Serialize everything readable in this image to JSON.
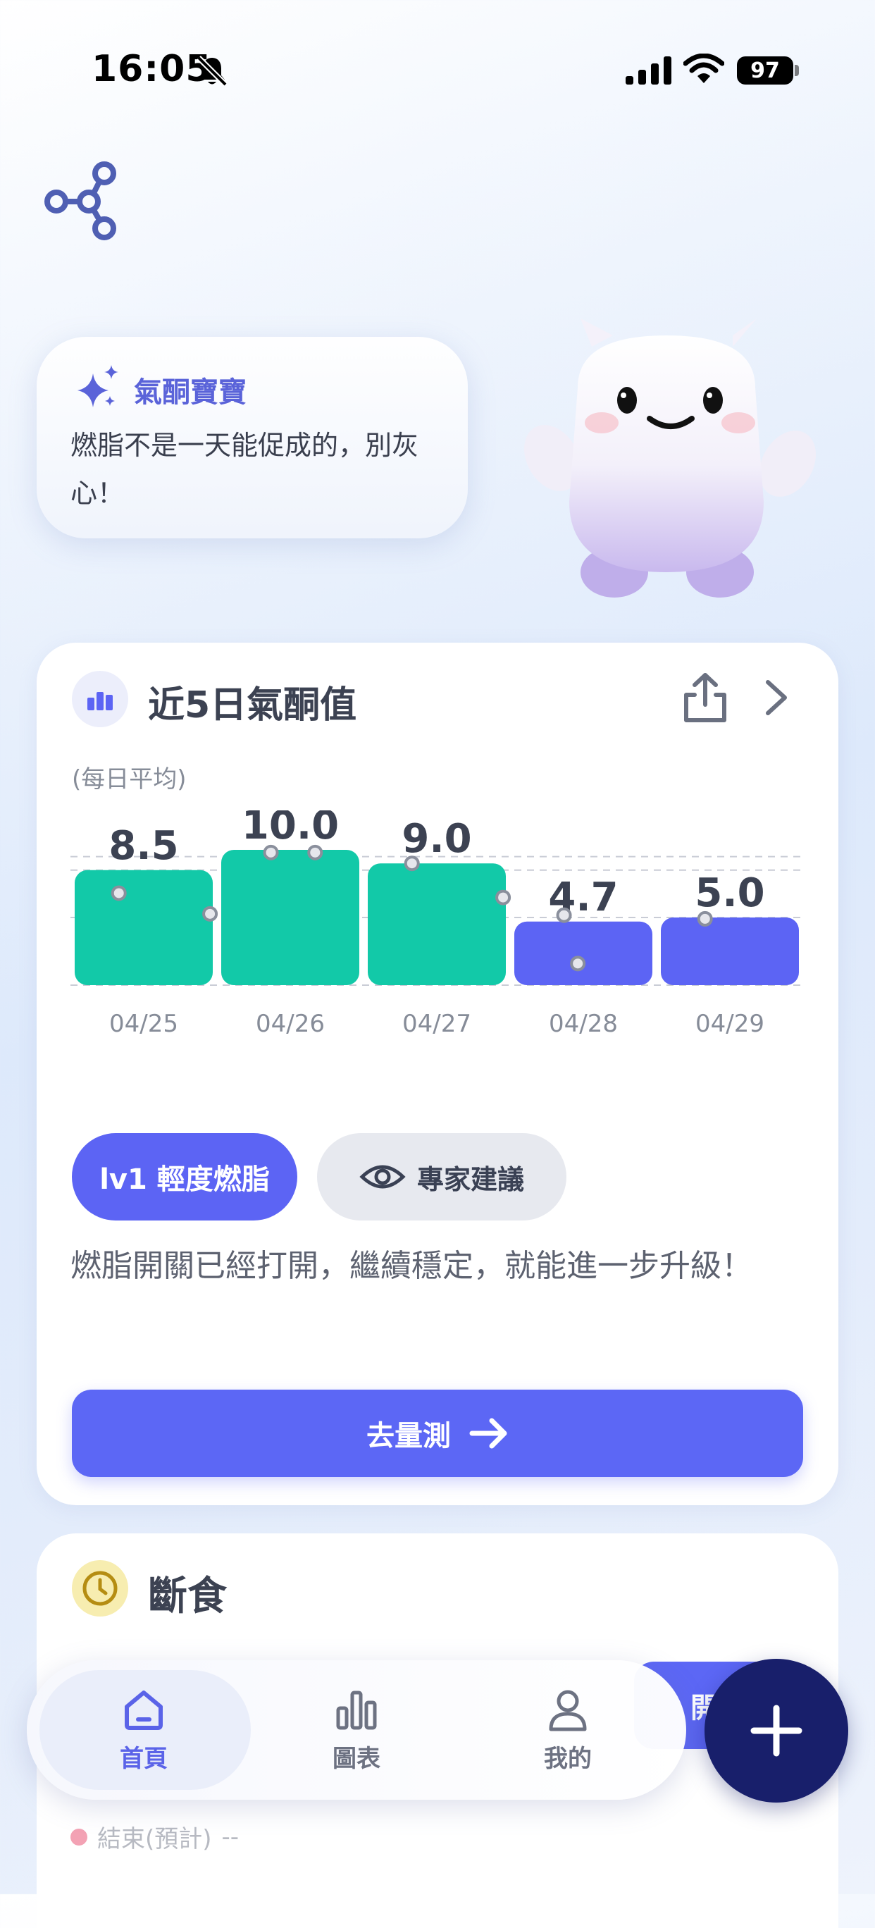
{
  "status_bar": {
    "time": "16:05",
    "battery": "97",
    "icons": [
      "bell-slash-icon",
      "signal-icon",
      "wifi-icon",
      "battery-icon"
    ]
  },
  "header": {
    "icon": "share-graph-icon"
  },
  "bubble": {
    "title": "氣酮寶寶",
    "message": "燃脂不是一天能促成的，別灰心！",
    "icon": "sparkle-icon"
  },
  "ketone_card": {
    "title": "近5日氣酮值",
    "subtitle": "(每日平均)",
    "level_label": "lv1 輕度燃脂",
    "expert_label": "專家建議",
    "description": "燃脂開關已經打開，繼續穩定，就能進一步升級！",
    "measure_label": "去量測",
    "colors": {
      "high": "#12c9a8",
      "low": "#5c64f4"
    }
  },
  "chart_data": {
    "type": "bar",
    "categories": [
      "04/25",
      "04/26",
      "04/27",
      "04/28",
      "04/29"
    ],
    "values": [
      8.5,
      10.0,
      9.0,
      4.7,
      5.0
    ],
    "value_labels": [
      "8.5",
      "10.0",
      "9.0",
      "4.7",
      "5.0"
    ],
    "title": "近5日氣酮值",
    "subtitle": "(每日平均)",
    "ylim": [
      0,
      11
    ],
    "grid": true,
    "bar_colors": [
      "#12c9a8",
      "#12c9a8",
      "#12c9a8",
      "#5c64f4",
      "#5c64f4"
    ]
  },
  "fasting_card": {
    "title": "斷食",
    "button_label": "開始",
    "end_label": "結束(預計)",
    "end_value": "--"
  },
  "bottom_nav": {
    "items": [
      {
        "label": "首頁",
        "icon": "home-icon",
        "active": true
      },
      {
        "label": "圖表",
        "icon": "bar-chart-icon",
        "active": false
      },
      {
        "label": "我的",
        "icon": "user-icon",
        "active": false
      }
    ],
    "fab_icon": "plus-icon"
  }
}
